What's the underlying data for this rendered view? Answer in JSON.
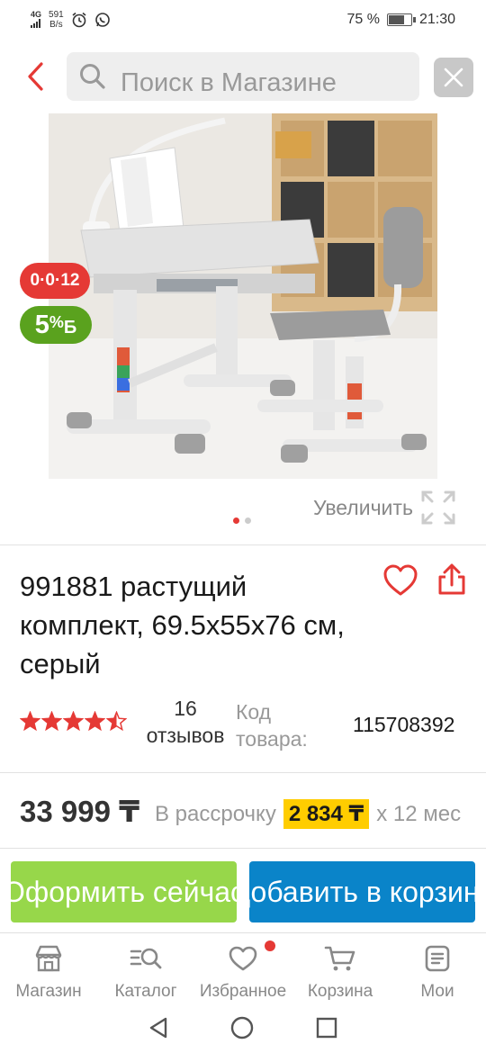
{
  "status_bar": {
    "network": "4G",
    "speed_value": "591",
    "speed_unit": "B/s",
    "battery_percent": "75 %",
    "battery_level": 0.75,
    "time": "21:30"
  },
  "search": {
    "placeholder": "Поиск в Магазине"
  },
  "badges": {
    "installment": "0·0·12",
    "bonus_value": "5",
    "bonus_percent": "%",
    "bonus_letter": "Б"
  },
  "gallery": {
    "zoom_label": "Увеличить",
    "slide_count": 2,
    "active_slide": 1
  },
  "product": {
    "title": "991881 растущий комплект, 69.5x55x76 см, серый",
    "rating": 4.5,
    "reviews_count": "16",
    "reviews_label": "отзывов",
    "code_label": "Код товара:",
    "code_value": "115708392"
  },
  "price": {
    "amount": "33 999 ₸",
    "installment_label": "В рассрочку",
    "installment_amount": "2 834 ₸",
    "installment_term": "x 12 мес"
  },
  "actions": {
    "checkout_label": "Оформить сейчас",
    "add_to_cart_label": "Добавить в корзину"
  },
  "tab_bar": {
    "items": [
      {
        "label": "Магазин",
        "icon": "shop-icon"
      },
      {
        "label": "Каталог",
        "icon": "catalog-search-icon"
      },
      {
        "label": "Избранное",
        "icon": "heart-icon"
      },
      {
        "label": "Корзина",
        "icon": "cart-icon"
      },
      {
        "label": "Мои",
        "icon": "orders-icon"
      }
    ]
  },
  "colors": {
    "accent_red": "#e53935",
    "checkout_green": "#97d74a",
    "cart_blue": "#0a84c9",
    "installment_yellow": "#ffcd00",
    "bonus_green": "#5aa21e"
  }
}
